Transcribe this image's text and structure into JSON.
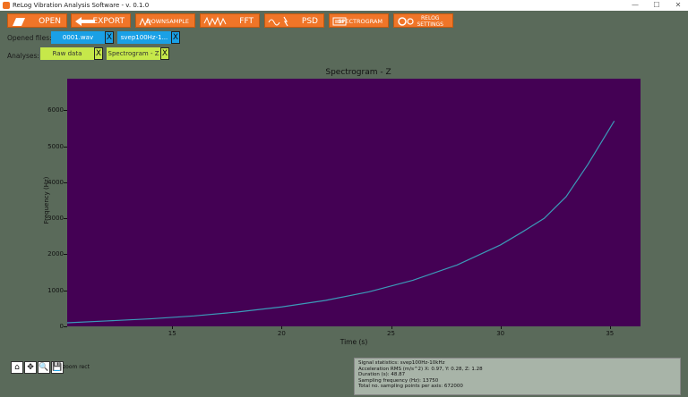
{
  "window": {
    "title": "ReLog Vibration Analysis Software - v. 0.1.0",
    "minimize": "—",
    "maximize": "☐",
    "close": "✕"
  },
  "toolbar": {
    "open": "OPEN",
    "export": "EXPORT",
    "downsample": "DOWNSAMPLE",
    "fft": "FFT",
    "psd": "PSD",
    "spectrogram": "SPECTROGRAM",
    "relog_settings_1": "RELOG",
    "relog_settings_2": "SETTINGS"
  },
  "files": {
    "label": "Opened files:",
    "items": [
      "0001.wav",
      "svep100Hz-1..."
    ],
    "close_glyph": "X"
  },
  "analyses": {
    "label": "Analyses:",
    "items": [
      "Raw data",
      "Spectrogram - Z"
    ],
    "close_glyph": "X"
  },
  "colors": {
    "toolbar": "#f07528",
    "file_chip": "#1aa0e6",
    "analysis_chip": "#c6e84a",
    "plot_bg": "#440154",
    "curve": "#3b9ab8"
  },
  "chart_data": {
    "type": "heatmap",
    "title": "Spectrogram - Z",
    "xlabel": "Time (s)",
    "ylabel": "Frequency (Hz)",
    "xlim": [
      10.2,
      36.4
    ],
    "ylim": [
      0,
      6875
    ],
    "xticks": [
      "15",
      "20",
      "25",
      "30",
      "35"
    ],
    "xtick_values": [
      15,
      20,
      25,
      30,
      35
    ],
    "yticks": [
      "0",
      "1000",
      "2000",
      "3000",
      "4000",
      "5000",
      "6000"
    ],
    "ytick_values": [
      0,
      1000,
      2000,
      3000,
      4000,
      5000,
      6000
    ],
    "series": [
      {
        "x": [
          10.2,
          12,
          14,
          16,
          18,
          20,
          22,
          24,
          26,
          28,
          30,
          31,
          32,
          33,
          34,
          35.2
        ],
        "y": [
          100,
          150,
          210,
          290,
          400,
          540,
          720,
          960,
          1280,
          1700,
          2260,
          2620,
          3000,
          3600,
          4500,
          5700
        ]
      }
    ],
    "colormap": "viridis"
  },
  "navbar": {
    "home": "⌂",
    "pan": "✥",
    "zoom": "🔍",
    "save": "💾",
    "mode": "zoom rect"
  },
  "stats": {
    "line1": "Signal statistics: svep100Hz-10kHz",
    "line2": "Acceleration RMS (m/s^2) X: 0.97, Y: 0.28, Z: 1.28",
    "line3": "Duration (s): 48.87",
    "line4": "Sampling frequency (Hz): 13750",
    "line5": "Total no. sampling points per axis: 672000"
  }
}
